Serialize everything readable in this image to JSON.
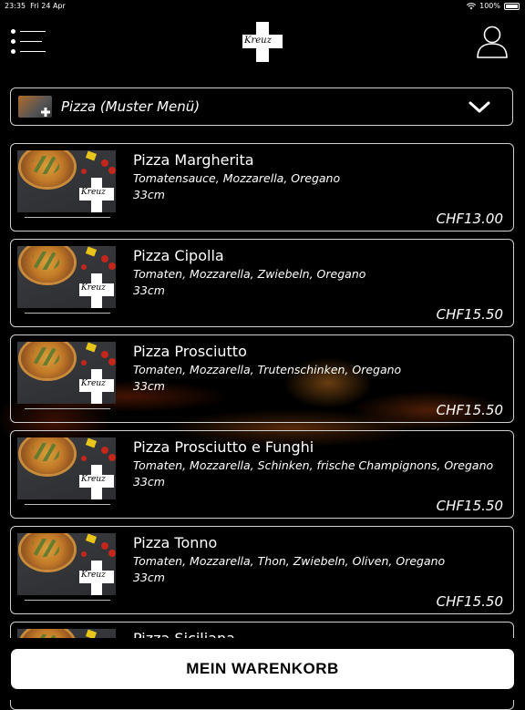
{
  "status_bar": {
    "time": "23:35",
    "date": "Fri 24 Apr",
    "battery": "100%",
    "icons": [
      "wifi-icon",
      "battery-icon"
    ]
  },
  "header": {
    "menu_icon": "hamburger-menu-icon",
    "logo_text": "Kreuz",
    "user_icon": "user-icon"
  },
  "category_select": {
    "label": "Pizza (Muster Menü)",
    "icon": "chevron-down-icon"
  },
  "menu_items": [
    {
      "name": "Pizza Margherita",
      "description": "Tomatensauce, Mozzarella, Oregano",
      "size": "33cm",
      "price": "CHF13.00"
    },
    {
      "name": "Pizza Cipolla",
      "description": "Tomaten, Mozzarella, Zwiebeln, Oregano",
      "size": "33cm",
      "price": "CHF15.50"
    },
    {
      "name": "Pizza Prosciutto",
      "description": "Tomaten, Mozzarella, Trutenschinken, Oregano",
      "size": "33cm",
      "price": "CHF15.50"
    },
    {
      "name": "Pizza Prosciutto e Funghi",
      "description": "Tomaten, Mozzarella, Schinken, frische Champignons, Oregano",
      "size": "33cm",
      "price": "CHF15.50"
    },
    {
      "name": "Pizza Tonno",
      "description": "Tomaten, Mozzarella, Thon, Zwiebeln, Oliven, Oregano",
      "size": "33cm",
      "price": "CHF15.50"
    },
    {
      "name": "Pizza Siciliana",
      "description": "",
      "size": "",
      "price": ""
    }
  ],
  "cart_button": {
    "label": "MEIN WARENKORB"
  },
  "colors": {
    "background": "#000000",
    "border": "#cfcfcf",
    "button_bg": "#ffffff"
  }
}
